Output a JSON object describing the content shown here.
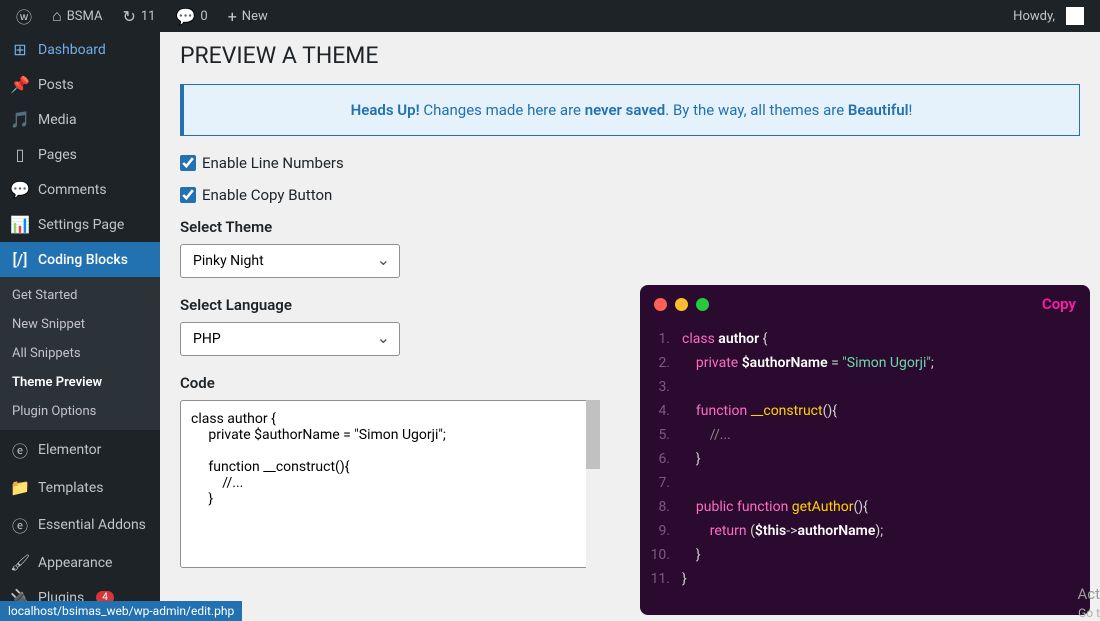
{
  "topbar": {
    "site_name": "BSMA",
    "updates_count": "11",
    "comments_count": "0",
    "new_label": "New",
    "howdy": "Howdy,"
  },
  "sidebar": {
    "dashboard": "Dashboard",
    "posts": "Posts",
    "media": "Media",
    "pages": "Pages",
    "comments": "Comments",
    "settings_page": "Settings Page",
    "coding_blocks": "Coding Blocks",
    "sub": {
      "get_started": "Get Started",
      "new_snippet": "New Snippet",
      "all_snippets": "All Snippets",
      "theme_preview": "Theme Preview",
      "plugin_options": "Plugin Options"
    },
    "elementor": "Elementor",
    "templates": "Templates",
    "essential_addons": "Essential Addons",
    "appearance": "Appearance",
    "plugins": "Plugins",
    "plugins_badge": "4"
  },
  "page": {
    "title": "PREVIEW A THEME",
    "notice_bold1": "Heads Up!",
    "notice_mid": " Changes made here are ",
    "notice_bold2": "never saved",
    "notice_mid2": ". By the way, all themes are ",
    "notice_bold3": "Beautiful",
    "notice_end": "!",
    "enable_line_numbers": "Enable Line Numbers",
    "enable_copy_button": "Enable Copy Button",
    "select_theme_label": "Select Theme",
    "theme_value": "Pinky Night",
    "select_language_label": "Select Language",
    "language_value": "PHP",
    "code_label": "Code",
    "code_text": "class author {\n     private $authorName = \"Simon Ugorji\";\n\n     function __construct(){\n         //...\n     }"
  },
  "preview": {
    "copy_label": "Copy"
  },
  "statusbar": {
    "url": "localhost/bsimas_web/wp-admin/edit.php"
  },
  "watermark": {
    "line1": "Act",
    "line2": "Go t"
  }
}
